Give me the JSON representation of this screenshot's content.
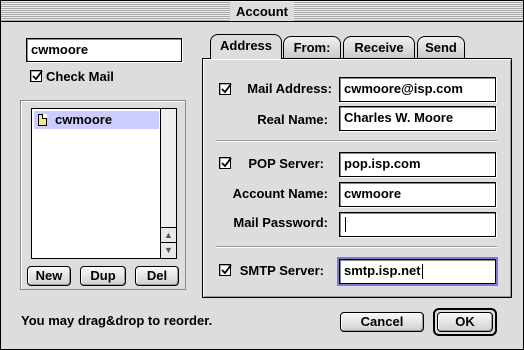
{
  "window": {
    "title": "Account"
  },
  "account_name_field": {
    "value": "cwmoore"
  },
  "check_mail": {
    "label": "Check Mail",
    "checked": true
  },
  "account_list": {
    "items": [
      {
        "name": "cwmoore",
        "selected": true
      }
    ]
  },
  "list_buttons": {
    "new": "New",
    "dup": "Dup",
    "del": "Del"
  },
  "tabs": [
    {
      "label": "Address",
      "active": true
    },
    {
      "label": "From:",
      "active": false
    },
    {
      "label": "Receive",
      "active": false
    },
    {
      "label": "Send",
      "active": false
    }
  ],
  "address_tab": {
    "mail_address": {
      "label": "Mail Address:",
      "value": "cwmoore@isp.com",
      "checked": true
    },
    "real_name": {
      "label": "Real Name:",
      "value": "Charles W. Moore"
    },
    "pop_server": {
      "label": "POP Server:",
      "value": "pop.isp.com",
      "checked": true
    },
    "account_name": {
      "label": "Account Name:",
      "value": "cwmoore"
    },
    "mail_password": {
      "label": "Mail Password:",
      "value": ""
    },
    "smtp_server": {
      "label": "SMTP Server:",
      "value": "smtp.isp.net",
      "checked": true
    }
  },
  "status_text": "You may drag&drop to reorder.",
  "footer_buttons": {
    "cancel": "Cancel",
    "ok": "OK"
  }
}
